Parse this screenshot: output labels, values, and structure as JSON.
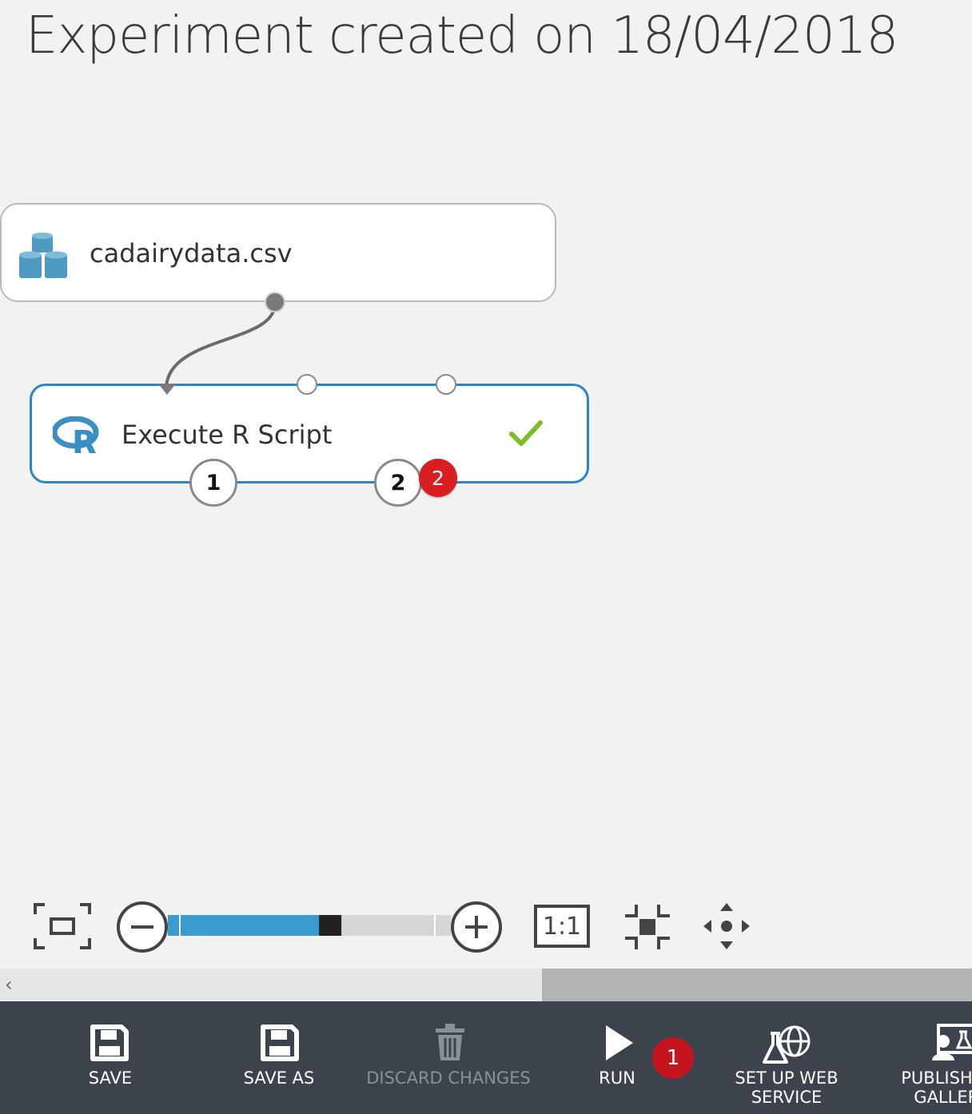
{
  "page": {
    "title": "Experiment created on 18/04/2018"
  },
  "modules": {
    "dataset": {
      "label": "cadairydata.csv",
      "icon": "dataset-icon"
    },
    "r_script": {
      "label": "Execute R Script",
      "icon": "r-logo-icon",
      "status_icon": "checkmark-icon"
    }
  },
  "ports": {
    "output_1": "1",
    "output_2": "2",
    "output_2_badge": "2"
  },
  "zoom": {
    "level": 0.58,
    "actual_size_label": "1:1"
  },
  "toolbar": {
    "save": "SAVE",
    "save_as": "SAVE AS",
    "discard": "DISCARD CHANGES",
    "run": "RUN",
    "run_badge": "1",
    "web_service": "SET UP WEB\nSERVICE",
    "publish": "PUBLISH TO\nGALLERY"
  },
  "colors": {
    "accent": "#2a86c8",
    "badge": "#d91d20",
    "check": "#7cbb2a",
    "toolbar_bg": "#3d434d"
  }
}
